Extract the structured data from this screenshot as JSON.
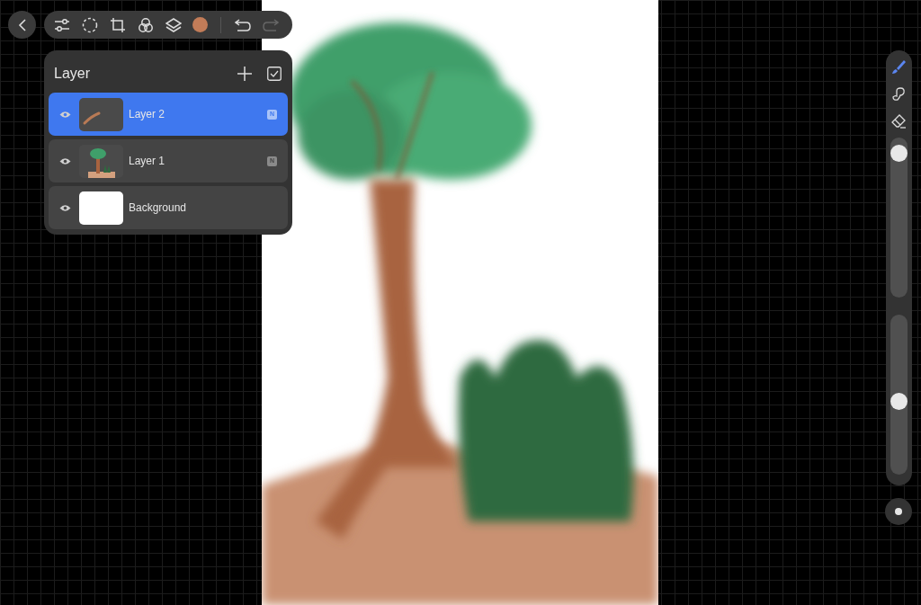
{
  "toolbar": {
    "tools": [
      {
        "kind": "adjust"
      },
      {
        "kind": "select"
      },
      {
        "kind": "transform"
      },
      {
        "kind": "blend"
      },
      {
        "kind": "layers"
      }
    ],
    "color": "#c27c58",
    "undo_enabled": true,
    "redo_enabled": false
  },
  "layers_panel": {
    "title": "Layer",
    "layers": [
      {
        "name": "Layer 2",
        "selected": true,
        "visible": true,
        "kind": "stroke",
        "blend_mode": "N"
      },
      {
        "name": "Layer 1",
        "selected": false,
        "visible": true,
        "kind": "tree",
        "blend_mode": "N"
      },
      {
        "name": "Background",
        "selected": false,
        "visible": true,
        "kind": "white"
      }
    ]
  },
  "side_tools": [
    {
      "kind": "brush",
      "selected": true
    },
    {
      "kind": "smudge",
      "selected": false
    },
    {
      "kind": "eraser",
      "selected": false
    }
  ],
  "size_slider": {
    "level": 0.95
  },
  "opacity_slider": {
    "level": 0.45
  }
}
